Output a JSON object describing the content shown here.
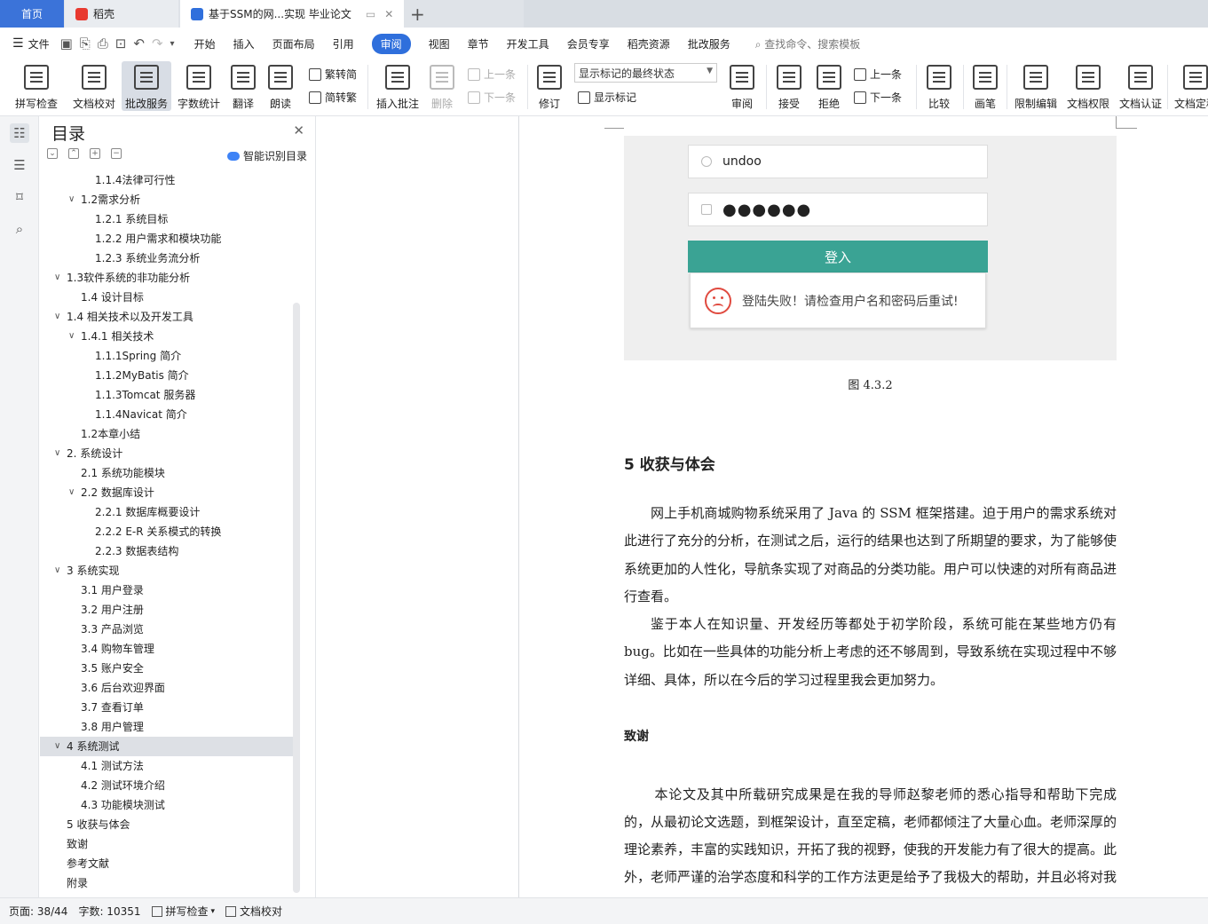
{
  "tabs": {
    "home": "首页",
    "daoke": "稻壳",
    "document": "基于SSM的网...实现 毕业论文",
    "new_tab": "+"
  },
  "menu": {
    "file": "文件",
    "items": [
      "开始",
      "插入",
      "页面布局",
      "引用",
      "审阅",
      "视图",
      "章节",
      "开发工具",
      "会员专享",
      "稻壳资源",
      "批改服务"
    ],
    "active": "审阅",
    "search_placeholder": "查找命令、搜索模板"
  },
  "ribbon": {
    "spellcheck": "拼写检查",
    "proofread": "文档校对",
    "correction_service": "批改服务",
    "word_count": "字数统计",
    "translate": "翻译",
    "read_aloud": "朗读",
    "to_traditional": "繁转简",
    "to_simplified": "简转繁",
    "insert_comment": "插入批注",
    "delete": "删除",
    "prev_comment": "上一条",
    "next_comment": "下一条",
    "track_changes": "修订",
    "markup_state": "显示标记的最终状态",
    "show_markup": "显示标记",
    "review": "审阅",
    "accept": "接受",
    "reject": "拒绝",
    "prev_change": "上一条",
    "next_change": "下一条",
    "compare": "比较",
    "pen": "画笔",
    "restrict_edit": "限制编辑",
    "doc_permission": "文档权限",
    "doc_certify": "文档认证",
    "doc_finalize": "文档定稿"
  },
  "toc": {
    "title": "目录",
    "smart_button": "智能识别目录",
    "items": [
      {
        "text": "1.1.4法律可行性",
        "level": 3
      },
      {
        "text": "1.2需求分析",
        "level": 2,
        "expanded": true
      },
      {
        "text": "1.2.1  系统目标",
        "level": 3
      },
      {
        "text": "1.2.2  用户需求和模块功能",
        "level": 3
      },
      {
        "text": "1.2.3  系统业务流分析",
        "level": 3
      },
      {
        "text": "1.3软件系统的非功能分析",
        "level": 1,
        "expanded": true
      },
      {
        "text": "1.4  设计目标",
        "level": 2
      },
      {
        "text": "1.4 相关技术以及开发工具",
        "level": 1,
        "expanded": true
      },
      {
        "text": "1.4.1 相关技术",
        "level": 2,
        "expanded": true
      },
      {
        "text": "1.1.1Spring 简介",
        "level": 3
      },
      {
        "text": "1.1.2MyBatis 简介",
        "level": 3
      },
      {
        "text": "1.1.3Tomcat 服务器",
        "level": 3
      },
      {
        "text": "1.1.4Navicat 简介",
        "level": 3
      },
      {
        "text": "1.2本章小结",
        "level": 2
      },
      {
        "text": "2.  系统设计",
        "level": 1,
        "expanded": true
      },
      {
        "text": "2.1  系统功能模块",
        "level": 2
      },
      {
        "text": "2.2  数据库设计",
        "level": 2,
        "expanded": true
      },
      {
        "text": "2.2.1  数据库概要设计",
        "level": 3
      },
      {
        "text": "2.2.2 E-R 关系模式的转换",
        "level": 3
      },
      {
        "text": "2.2.3  数据表结构",
        "level": 3
      },
      {
        "text": "3  系统实现",
        "level": 1,
        "expanded": true
      },
      {
        "text": "3.1  用户登录",
        "level": 2
      },
      {
        "text": "3.2  用户注册",
        "level": 2
      },
      {
        "text": "3.3 产品浏览",
        "level": 2
      },
      {
        "text": "3.4  购物车管理",
        "level": 2
      },
      {
        "text": "3.5  账户安全",
        "level": 2
      },
      {
        "text": "3.6  后台欢迎界面",
        "level": 2
      },
      {
        "text": "3.7  查看订单",
        "level": 2
      },
      {
        "text": "3.8  用户管理",
        "level": 2
      },
      {
        "text": "4  系统测试",
        "level": 1,
        "expanded": true,
        "selected": true
      },
      {
        "text": "4.1  测试方法",
        "level": 2
      },
      {
        "text": "4.2  测试环境介绍",
        "level": 2
      },
      {
        "text": "4.3  功能模块测试",
        "level": 2
      },
      {
        "text": "5  收获与体会",
        "level": 1
      },
      {
        "text": "致谢",
        "level": 1
      },
      {
        "text": "参考文献",
        "level": 1
      },
      {
        "text": "附录",
        "level": 1
      }
    ]
  },
  "document": {
    "figure": {
      "username": "undoo",
      "password_mask": "●●●●●●",
      "login_button": "登入",
      "error_message": "登陆失败！请检查用户名和密码后重试!",
      "caption": "图 4.3.2"
    },
    "section_heading": "5  收获与体会",
    "paragraph1": "网上手机商城购物系统采用了 Java 的 SSM 框架搭建。迫于用户的需求系统对此进行了充分的分析，在测试之后，运行的结果也达到了所期望的要求，为了能够使系统更加的人性化，导航条实现了对商品的分类功能。用户可以快速的对所有商品进行查看。",
    "paragraph2": "鉴于本人在知识量、开发经历等都处于初学阶段，系统可能在某些地方仍有 bug。比如在一些具体的功能分析上考虑的还不够周到，导致系统在实现过程中不够详细、具体，所以在今后的学习过程里我会更加努力。",
    "ack_heading": "致谢",
    "paragraph3": "本论文及其中所载研究成果是在我的导师赵黎老师的悉心指导和帮助下完成的，从最初论文选题，到框架设计，直至定稿，老师都倾注了大量心血。老师深厚的理论素养，丰富的实践知识，开拓了我的视野，使我的开发能力有了很大的提高。此外，老师严谨的治学态度和科学的工作方法更是给予了我极大的帮助，并且必将对我今后的工作和生活产生极为深远的影响。在此衷心感谢赵黎老师对"
  },
  "status": {
    "page": "页面: 38/44",
    "word_count": "字数: 10351",
    "spellcheck": "拼写检查",
    "proofread": "文档校对"
  },
  "colors": {
    "accent": "#2f6fdc",
    "home_tab": "#3b73d9",
    "login_button": "#3aa394",
    "error_icon": "#e04a3f",
    "selected_toc": "#dde0e5"
  }
}
